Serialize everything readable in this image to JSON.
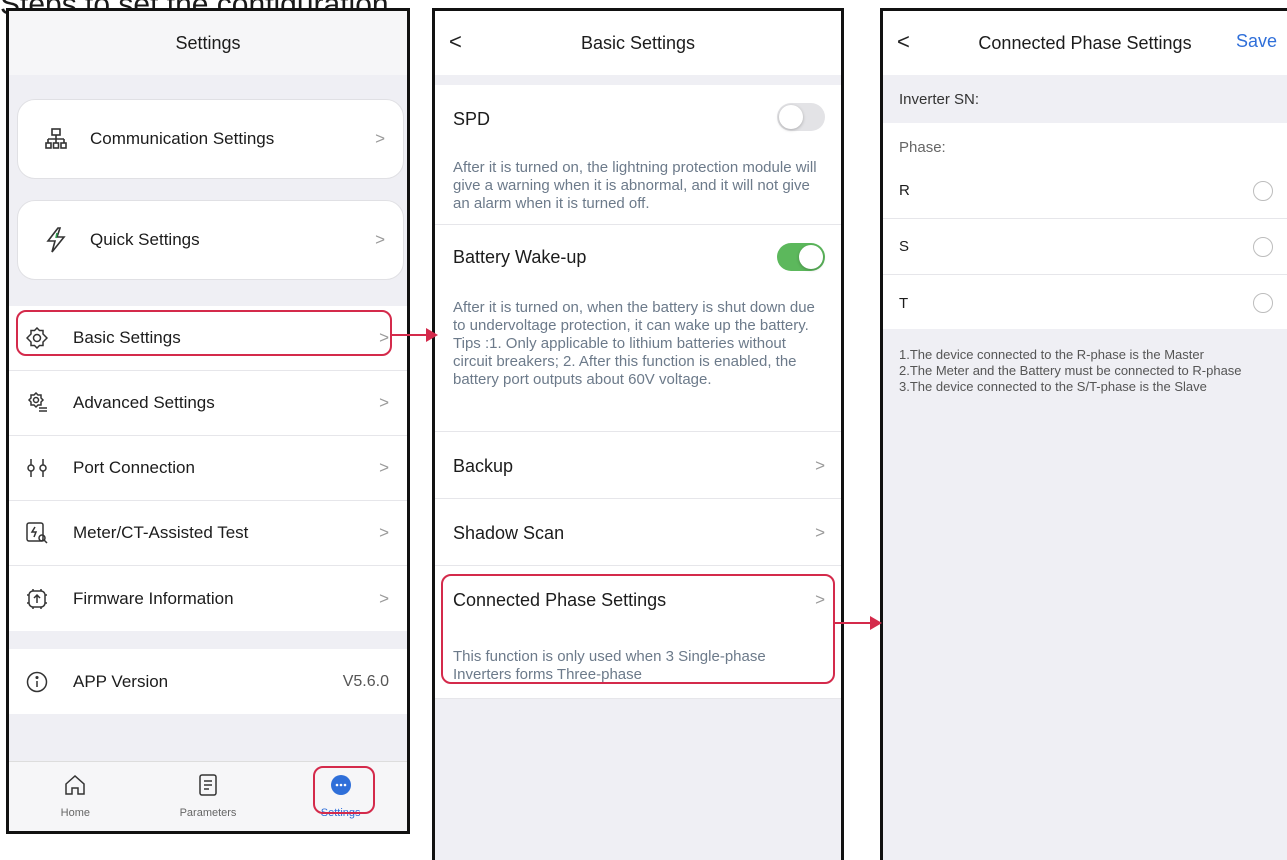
{
  "caption": "Steps to set the configuration",
  "screen1": {
    "title": "Settings",
    "cards": [
      {
        "label": "Communication Settings",
        "icon": "network-icon"
      },
      {
        "label": "Quick Settings",
        "icon": "lightning-icon"
      }
    ],
    "list1": [
      {
        "label": "Basic Settings",
        "icon": "gear-icon"
      },
      {
        "label": "Advanced Settings",
        "icon": "advanced-gear-icon"
      },
      {
        "label": "Port Connection",
        "icon": "port-icon"
      },
      {
        "label": "Meter/CT-Assisted Test",
        "icon": "meter-test-icon"
      },
      {
        "label": "Firmware Information",
        "icon": "firmware-icon"
      }
    ],
    "app_version": {
      "label": "APP Version",
      "value": "V5.6.0"
    },
    "tabs": [
      {
        "label": "Home",
        "icon": "home-icon"
      },
      {
        "label": "Parameters",
        "icon": "document-icon"
      },
      {
        "label": "Settings",
        "icon": "more-icon"
      }
    ]
  },
  "screen2": {
    "back": "<",
    "title": "Basic Settings",
    "spd": {
      "title": "SPD",
      "enabled": false,
      "desc": "After it is turned on, the lightning protection module will give a warning when it is abnormal, and it will not give an alarm when it is turned off."
    },
    "wakeup": {
      "title": "Battery Wake-up",
      "enabled": true,
      "desc": "After it is turned on,  when the battery is shut down due to undervoltage protection, it can wake up the battery.\nTips :1. Only applicable to lithium batteries without circuit breakers; 2. After this function is enabled, the battery port outputs about 60V voltage."
    },
    "backup": "Backup",
    "shadow_scan": "Shadow Scan",
    "connected_phase": {
      "title": "Connected Phase Settings",
      "desc": "This function is only used when 3 Single-phase Inverters forms Three-phase"
    }
  },
  "screen3": {
    "back": "<",
    "title": "Connected Phase Settings",
    "save": "Save",
    "inverter_sn": "Inverter SN:",
    "phase_label": "Phase:",
    "phases": [
      "R",
      "S",
      "T"
    ],
    "notes": "1.The device connected to the R-phase is the Master\n2.The Meter and the Battery must be connected to R-phase\n3.The device connected to the S/T-phase is the Slave"
  },
  "colors": {
    "accent_red": "#d42a4b",
    "toggle_on": "#5cb85c",
    "link_blue": "#2f6fd9"
  }
}
